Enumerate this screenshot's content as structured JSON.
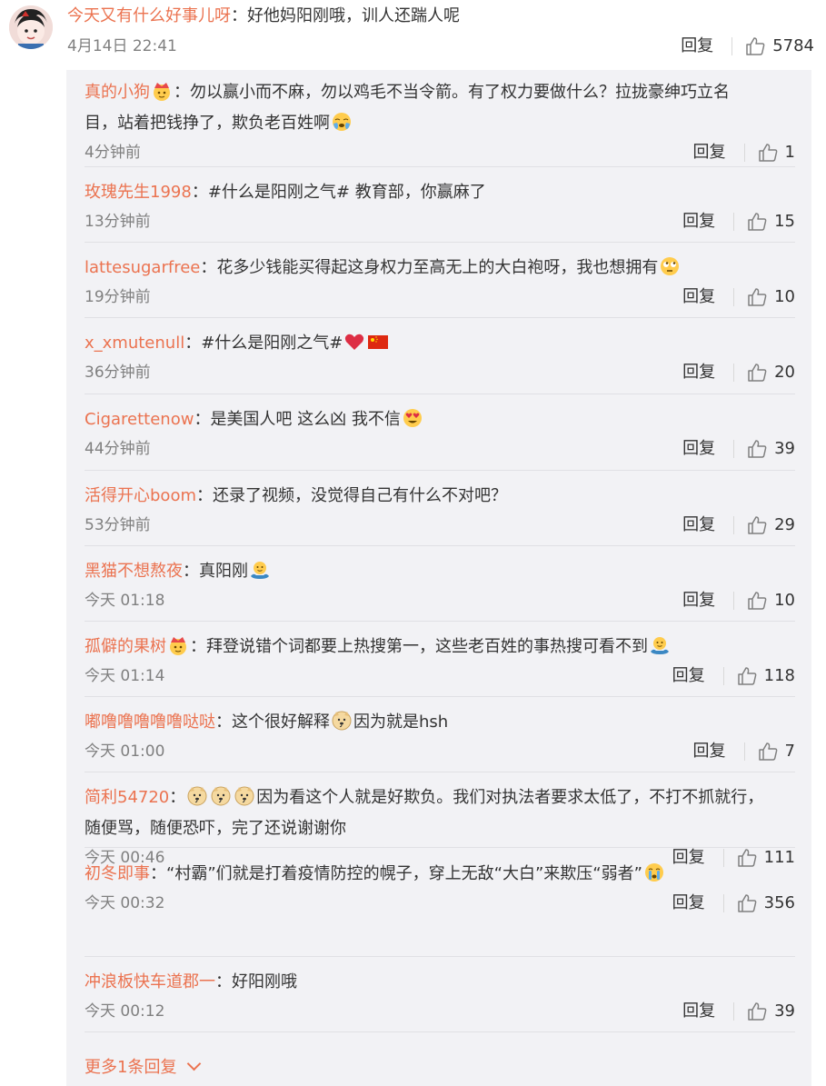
{
  "main_comment": {
    "username": "今天又有什么好事儿呀",
    "separator": "：",
    "text": "好他妈阳刚哦，训人还踹人呢",
    "time": "4月14日 22:41",
    "reply_label": "回复",
    "likes": "5784"
  },
  "replies": [
    {
      "username": "真的小狗",
      "badge": "crown-emoji-icon",
      "sep": "：",
      "text": "勿以赢小而不麻，勿以鸡毛不当令箭。有了权力要做什么？拉拢豪绅巧立名",
      "text2": "目，站着把钱挣了，欺负老百姓啊",
      "emoji_end": "crying-emoji-icon",
      "time": "4分钟前",
      "reply_label": "回复",
      "likes": "1"
    },
    {
      "username": "玫瑰先生1998",
      "sep": "：",
      "text": "#什么是阳刚之气# 教育部，你赢麻了",
      "time": "13分钟前",
      "reply_label": "回复",
      "likes": "15"
    },
    {
      "username": "lattesugarfree",
      "sep": "：",
      "text": "花多少钱能买得起这身权力至高无上的大白袍呀，我也想拥有",
      "emoji_end": "eye-roll-emoji-icon",
      "time": "19分钟前",
      "reply_label": "回复",
      "likes": "10"
    },
    {
      "username": "x_xmutenull",
      "sep": "：",
      "text": "#什么是阳刚之气#",
      "emoji_end": "heart-emoji-icon",
      "emoji_end2": "china-flag-icon",
      "time": "36分钟前",
      "reply_label": "回复",
      "likes": "20"
    },
    {
      "username": "Cigarettenow",
      "sep": "：",
      "text": "是美国人吧 这么凶 我不信",
      "emoji_end": "heart-eyes-emoji-icon",
      "time": "44分钟前",
      "reply_label": "回复",
      "likes": "39"
    },
    {
      "username": "活得开心boom",
      "sep": "：",
      "text": "还录了视频，没觉得自己有什么不对吧？",
      "time": "53分钟前",
      "reply_label": "回复",
      "likes": "29"
    },
    {
      "username": "黑猫不想熬夜",
      "sep": "：",
      "text": "真阳刚",
      "emoji_end": "shrug-emoji-icon",
      "time": "今天 01:18",
      "reply_label": "回复",
      "likes": "10"
    },
    {
      "username": "孤僻的果树",
      "badge": "crown-emoji-icon",
      "sep": "：",
      "text": "拜登说错个词都要上热搜第一，这些老百姓的事热搜可看不到",
      "emoji_end": "shrug-emoji-icon",
      "time": "今天 01:14",
      "reply_label": "回复",
      "likes": "118"
    },
    {
      "username": "嘟噜噜噜噜噜哒哒",
      "sep": "：",
      "text": "这个很好解释",
      "emoji_mid": "doge-emoji-icon",
      "text_after": "因为就是hsh",
      "time": "今天 01:00",
      "reply_label": "回复",
      "likes": "7"
    },
    {
      "username": "简利54720",
      "sep": "：",
      "emoji_lead": "doge-emoji-icon",
      "text": "因为看这个人就是好欺负。我们对执法者要求太低了，不打不抓就行，",
      "text2": "随便骂，随便恐吓，完了还说谢谢你",
      "time": "今天 00:46",
      "reply_label": "回复",
      "likes": "111"
    },
    {
      "username": "初冬即事",
      "sep": "：",
      "text": "“村霸”们就是打着疫情防控的幌子，穿上无敌“大白”来欺压“弱者”",
      "emoji_end": "crying-face-emoji-icon",
      "time": "今天 00:32",
      "reply_label": "回复",
      "likes": "356"
    },
    {
      "username": "冲浪板快车道郡一",
      "sep": "：",
      "text": "好阳刚哦",
      "time": "今天 00:12",
      "reply_label": "回复",
      "likes": "39"
    }
  ],
  "more_replies": "更多1条回复",
  "colors": {
    "username": "#eb7350",
    "text": "#333333",
    "meta": "#808080",
    "sub_bg": "#f2f2f5"
  }
}
